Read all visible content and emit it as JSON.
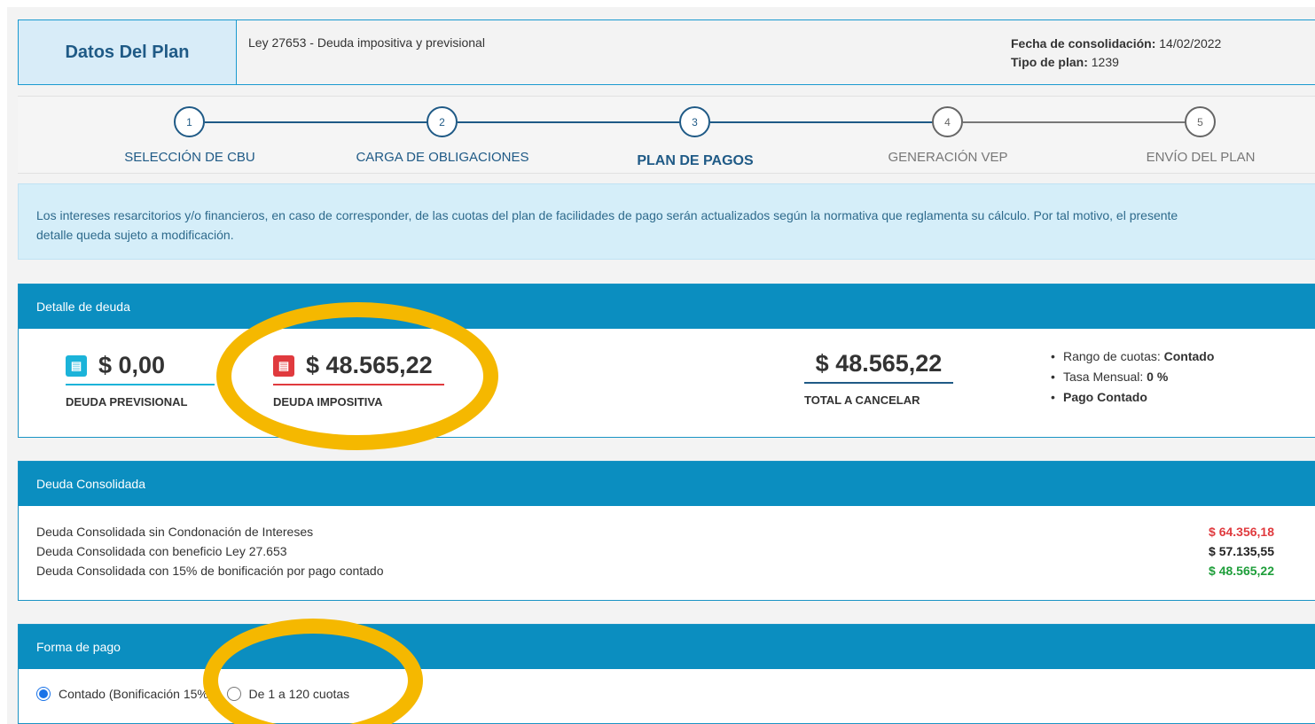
{
  "plan": {
    "title": "Datos Del Plan",
    "ley": "Ley 27653 - Deuda impositiva y previsional",
    "fecha_label": "Fecha de consolidación:",
    "fecha_value": "14/02/2022",
    "tipo_label": "Tipo de plan:",
    "tipo_value": "1239"
  },
  "stepper": {
    "steps": [
      {
        "number": "1",
        "label": "SELECCIÓN DE CBU",
        "state": "done"
      },
      {
        "number": "2",
        "label": "CARGA DE OBLIGACIONES",
        "state": "done"
      },
      {
        "number": "3",
        "label": "PLAN DE PAGOS",
        "state": "active"
      },
      {
        "number": "4",
        "label": "GENERACIÓN VEP",
        "state": "todo"
      },
      {
        "number": "5",
        "label": "ENVÍO DEL PLAN",
        "state": "todo"
      }
    ]
  },
  "info": {
    "line1": "Los intereses resarcitorios y/o financieros, en caso de corresponder, de las cuotas del plan de facilidades de pago serán actualizados según la normativa que reglamenta su cálculo. Por tal motivo, el presente",
    "line2": "detalle queda sujeto a modificación."
  },
  "detalle": {
    "header": "Detalle de deuda",
    "previsional_amount": "$ 0,00",
    "previsional_label": "DEUDA PREVISIONAL",
    "impositiva_amount": "$ 48.565,22",
    "impositiva_label": "DEUDA IMPOSITIVA",
    "total_amount": "$ 48.565,22",
    "total_label": "TOTAL A CANCELAR",
    "rango_label": "Rango de cuotas:",
    "rango_value": "Contado",
    "tasa_label": "Tasa Mensual:",
    "tasa_value": "0 %",
    "pago": "Pago Contado",
    "colors": {
      "previsional": "#1bb3d9",
      "impositiva": "#e03a3e",
      "total": "#1f5a86"
    }
  },
  "consolidada": {
    "header": "Deuda Consolidada",
    "rows": [
      {
        "label": "Deuda Consolidada sin Condonación de Intereses",
        "value": "$ 64.356,18",
        "color": "#e03a3e"
      },
      {
        "label": "Deuda Consolidada con beneficio Ley 27.653",
        "value": "$ 57.135,55",
        "color": "#222222"
      },
      {
        "label": "Deuda Consolidada con 15% de bonificación por pago contado",
        "value": "$ 48.565,22",
        "color": "#1e9e3a"
      }
    ]
  },
  "forma_pago": {
    "header": "Forma de pago",
    "option1": "Contado (Bonificación 15%)",
    "option2": "De 1 a 120 cuotas",
    "selected": "option1"
  }
}
